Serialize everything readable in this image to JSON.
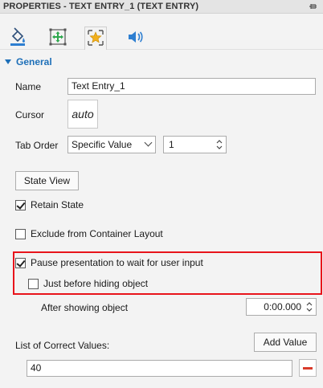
{
  "panel": {
    "title": "PROPERTIES - TEXT ENTRY_1 (TEXT ENTRY)",
    "pin_icon": "pin-icon"
  },
  "tabs": [
    {
      "icon": "fill-bucket-icon",
      "active": false
    },
    {
      "icon": "size-position-icon",
      "active": false
    },
    {
      "icon": "interaction-star-icon",
      "active": true
    },
    {
      "icon": "audio-speaker-icon",
      "active": false
    }
  ],
  "section": {
    "label": "General",
    "expanded": true
  },
  "name": {
    "label": "Name",
    "value": "Text Entry_1"
  },
  "cursor": {
    "label": "Cursor",
    "value": "auto"
  },
  "tab_order": {
    "label": "Tab Order",
    "mode": "Specific Value",
    "number": "1"
  },
  "state_view": {
    "label": "State View"
  },
  "retain_state": {
    "label": "Retain State",
    "checked": true
  },
  "exclude_container": {
    "label": "Exclude from Container Layout",
    "checked": false
  },
  "pause": {
    "label": "Pause presentation to wait for user input",
    "checked": true
  },
  "before_hiding": {
    "label": "Just before hiding object",
    "checked": false
  },
  "after_showing": {
    "label": "After showing object",
    "value": "0:00.000"
  },
  "correct_values": {
    "label": "List of Correct Values:",
    "add_label": "Add Value",
    "items": [
      "40"
    ]
  },
  "colors": {
    "accent": "#1d6fb8",
    "highlight": "#e8141b",
    "remove": "#d93b2b"
  }
}
